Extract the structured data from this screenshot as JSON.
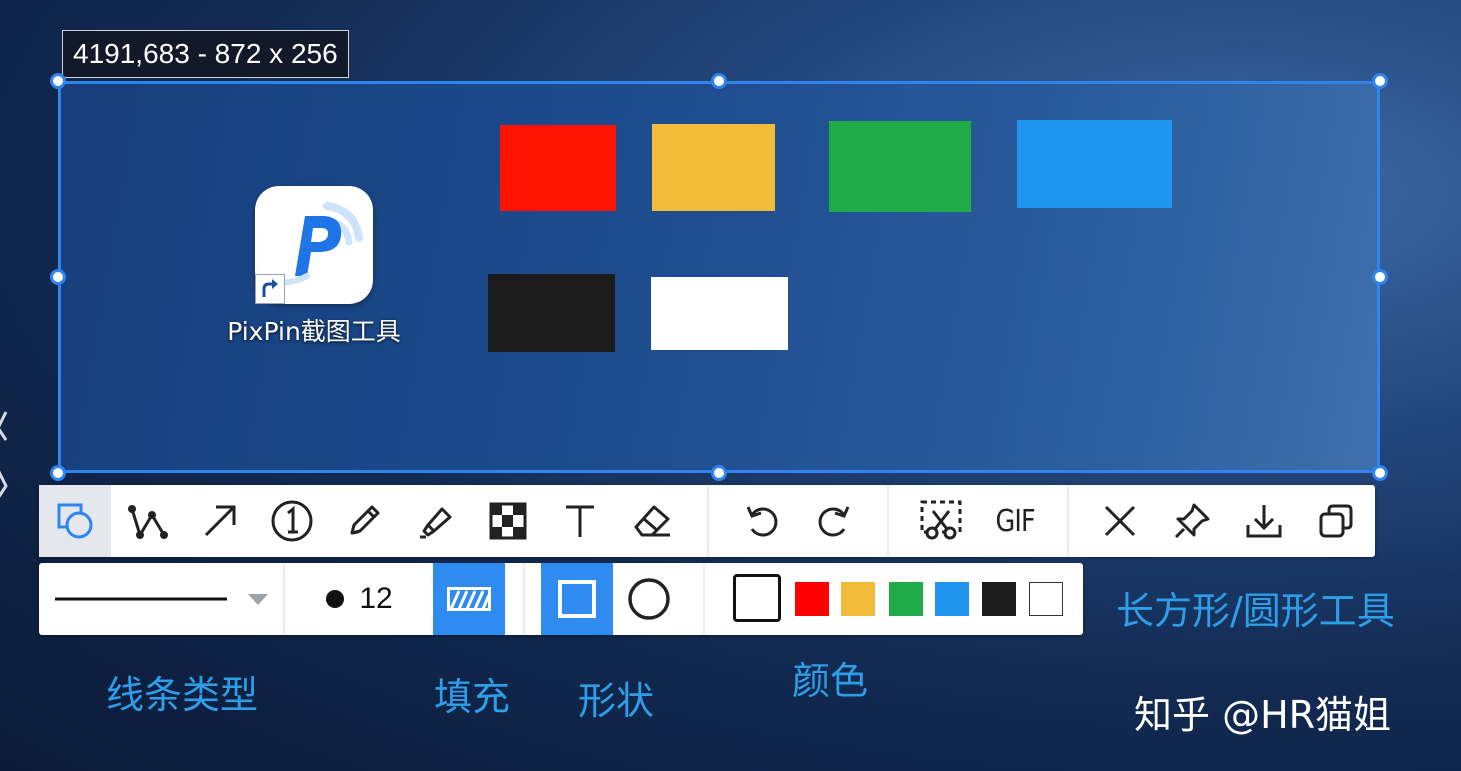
{
  "coordinate_readout": "4191,683 - 872 x 256",
  "desktop_icon": {
    "label": "PixPin截图工具",
    "icon": "pixpin-app-icon"
  },
  "color_blocks": [
    {
      "name": "red-block",
      "color": "#fe1200"
    },
    {
      "name": "yellow-block",
      "color": "#f1bc39"
    },
    {
      "name": "green-block",
      "color": "#20ab48"
    },
    {
      "name": "blue-block",
      "color": "#2096f1"
    },
    {
      "name": "black-block",
      "color": "#1b1b1b"
    },
    {
      "name": "white-block",
      "color": "#ffffff"
    }
  ],
  "toolbar": {
    "tools": [
      {
        "icon": "shape-icon",
        "active": true
      },
      {
        "icon": "polyline-icon"
      },
      {
        "icon": "arrow-icon"
      },
      {
        "icon": "number-marker-icon",
        "text": "1"
      },
      {
        "icon": "pencil-icon"
      },
      {
        "icon": "highlighter-icon"
      },
      {
        "icon": "mosaic-icon"
      },
      {
        "icon": "text-icon"
      },
      {
        "icon": "eraser-icon"
      }
    ],
    "history": [
      {
        "icon": "undo-icon"
      },
      {
        "icon": "redo-icon"
      }
    ],
    "capture": [
      {
        "icon": "scissors-icon"
      },
      {
        "icon": "gif-icon",
        "text": "GIF"
      }
    ],
    "actions": [
      {
        "icon": "close-icon"
      },
      {
        "icon": "pin-icon"
      },
      {
        "icon": "download-icon"
      },
      {
        "icon": "copy-icon"
      }
    ]
  },
  "properties": {
    "line_type_icon": "chevron-down-icon",
    "line_size": "12",
    "fill_icon": "hatch-fill-icon",
    "shapes": [
      {
        "icon": "square-icon",
        "selected": true
      },
      {
        "icon": "circle-icon",
        "selected": false
      }
    ],
    "swatches": [
      {
        "color": "#ffffff",
        "selected": true
      },
      {
        "color": "#ff0000"
      },
      {
        "color": "#f1bc39"
      },
      {
        "color": "#20ab48"
      },
      {
        "color": "#2096f1"
      },
      {
        "color": "#1b1b1b"
      },
      {
        "color": "#ffffff"
      }
    ]
  },
  "captions": {
    "line_type": "线条类型",
    "fill": "填充",
    "shape": "形状",
    "color": "颜色",
    "tool_name": "长方形/圆形工具"
  },
  "watermark": "知乎 @HR猫姐",
  "accent_color": "#2f84ee",
  "caption_color": "#2e9ee8"
}
